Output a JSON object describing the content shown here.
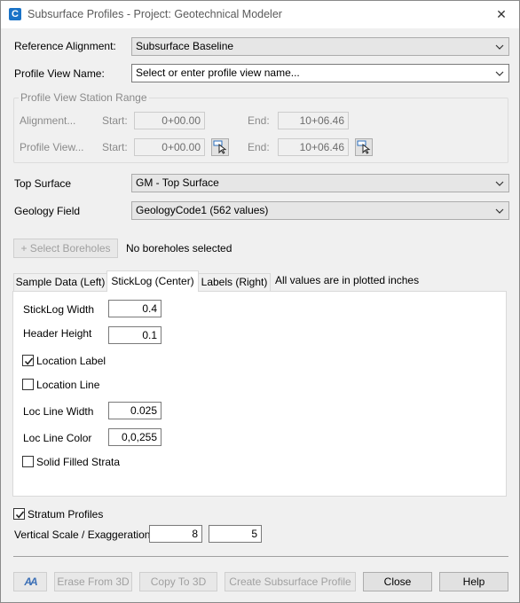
{
  "window": {
    "title": "Subsurface Profiles - Project: Geotechnical Modeler",
    "close_glyph": "✕",
    "app_icon_letter": "C"
  },
  "reference_alignment": {
    "label": "Reference Alignment:",
    "value": "Subsurface Baseline"
  },
  "profile_view_name": {
    "label": "Profile View Name:",
    "value": "Select or enter profile view name..."
  },
  "station_range": {
    "title": "Profile View Station Range",
    "alignment_label": "Alignment...",
    "profile_view_label": "Profile View...",
    "start_label": "Start:",
    "end_label": "End:",
    "alignment_start": "0+00.00",
    "alignment_end": "10+06.46",
    "profile_start": "0+00.00",
    "profile_end": "10+06.46"
  },
  "top_surface": {
    "label": "Top Surface",
    "value": "GM - Top Surface"
  },
  "geology_field": {
    "label": "Geology Field",
    "value": "GeologyCode1 (562 values)"
  },
  "boreholes": {
    "button_label": "+ Select Boreholes",
    "status": "No boreholes selected"
  },
  "tabs": [
    {
      "label": "Sample Data (Left)",
      "active": false
    },
    {
      "label": "StickLog (Center)",
      "active": true
    },
    {
      "label": "Labels (Right)",
      "active": false
    }
  ],
  "tabs_note": "All values are in plotted inches",
  "sticklog": {
    "width_label": "StickLog Width",
    "width_value": "0.4",
    "header_height_label": "Header Height",
    "header_height_value": "0.1",
    "location_label": {
      "label": "Location Label",
      "checked": true
    },
    "location_line": {
      "label": "Location Line",
      "checked": false
    },
    "loc_line_width_label": "Loc Line Width",
    "loc_line_width_value": "0.025",
    "loc_line_color_label": "Loc Line Color",
    "loc_line_color_value": "0,0,255",
    "solid_filled_strata": {
      "label": "Solid Filled Strata",
      "checked": false
    }
  },
  "stratum_profiles": {
    "label": "Stratum Profiles",
    "checked": true
  },
  "vertical_scale": {
    "label": "Vertical Scale / Exaggeration:",
    "scale": "8",
    "exaggeration": "5"
  },
  "footer": {
    "font_icon_text": "AA",
    "erase_label": "Erase From 3D",
    "copy_label": "Copy To 3D",
    "create_label": "Create Subsurface Profile",
    "close_label": "Close",
    "help_label": "Help"
  }
}
